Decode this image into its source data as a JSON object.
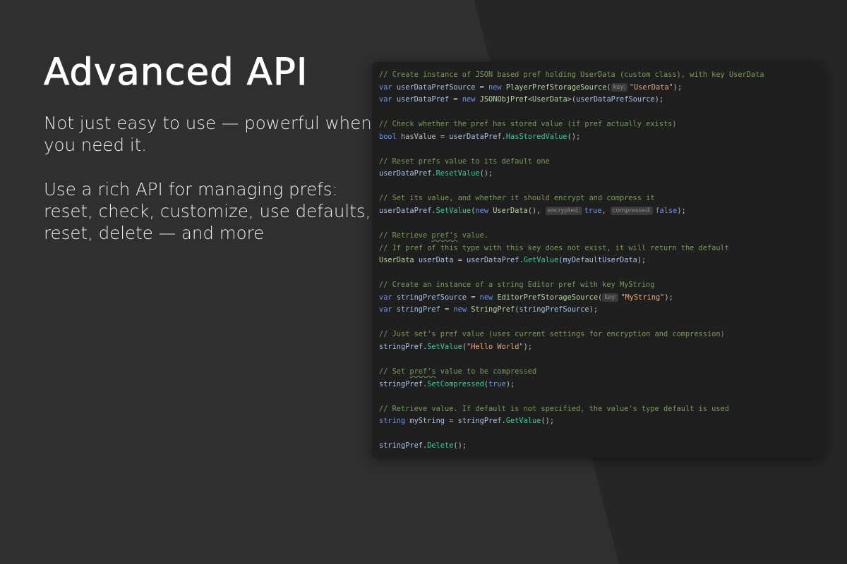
{
  "colors": {
    "background": "#2f2f2f",
    "background_shape": "#262626",
    "code_panel_bg": "#1f1f1f",
    "comment": "#7a9a5a",
    "keyword": "#6c95eb",
    "type": "#b8d7a3",
    "method": "#39cc9b",
    "string": "#e9a87d",
    "text": "#bcbec4"
  },
  "hero": {
    "title": "Advanced API",
    "paragraph_1": "Not just easy to use — powerful when you need it.",
    "paragraph_2": "Use a rich API for managing prefs: reset, check, customize, use defaults, reset, delete — and more"
  },
  "code": {
    "lines": [
      [
        {
          "t": "// Create instance of JSON based pref holding UserData (custom class), with key UserData",
          "k": "comment"
        }
      ],
      [
        {
          "t": "var",
          "k": "kw"
        },
        {
          "t": " ",
          "k": "plain"
        },
        {
          "t": "userDataPrefSource",
          "k": "var"
        },
        {
          "t": " = ",
          "k": "plain"
        },
        {
          "t": "new",
          "k": "kw"
        },
        {
          "t": " ",
          "k": "plain"
        },
        {
          "t": "PlayerPrefStorageSource",
          "k": "type"
        },
        {
          "t": "(",
          "k": "plain"
        },
        {
          "t": "key:",
          "k": "hint"
        },
        {
          "t": "\"UserData\"",
          "k": "str"
        },
        {
          "t": ");",
          "k": "plain"
        }
      ],
      [
        {
          "t": "var",
          "k": "kw"
        },
        {
          "t": " ",
          "k": "plain"
        },
        {
          "t": "userDataPref",
          "k": "var"
        },
        {
          "t": " = ",
          "k": "plain"
        },
        {
          "t": "new",
          "k": "kw"
        },
        {
          "t": " ",
          "k": "plain"
        },
        {
          "t": "JSONObjPref",
          "k": "type"
        },
        {
          "t": "<",
          "k": "plain"
        },
        {
          "t": "UserData",
          "k": "type"
        },
        {
          "t": ">(",
          "k": "plain"
        },
        {
          "t": "userDataPrefSource",
          "k": "var"
        },
        {
          "t": ");",
          "k": "plain"
        }
      ],
      [],
      [
        {
          "t": "// Check whether the pref has stored value (if pref actually exists)",
          "k": "comment"
        }
      ],
      [
        {
          "t": "bool",
          "k": "kw"
        },
        {
          "t": " ",
          "k": "plain"
        },
        {
          "t": "hasValue",
          "k": "local"
        },
        {
          "t": " = ",
          "k": "plain"
        },
        {
          "t": "userDataPref",
          "k": "var"
        },
        {
          "t": ".",
          "k": "plain"
        },
        {
          "t": "HasStoredValue",
          "k": "method"
        },
        {
          "t": "();",
          "k": "plain"
        }
      ],
      [],
      [
        {
          "t": "// Reset prefs value to its default one",
          "k": "comment"
        }
      ],
      [
        {
          "t": "userDataPref",
          "k": "var"
        },
        {
          "t": ".",
          "k": "plain"
        },
        {
          "t": "ResetValue",
          "k": "method"
        },
        {
          "t": "();",
          "k": "plain"
        }
      ],
      [],
      [
        {
          "t": "// Set its value, and whether it should encrypt and compress it",
          "k": "comment"
        }
      ],
      [
        {
          "t": "userDataPref",
          "k": "var"
        },
        {
          "t": ".",
          "k": "plain"
        },
        {
          "t": "SetValue",
          "k": "method"
        },
        {
          "t": "(",
          "k": "plain"
        },
        {
          "t": "new",
          "k": "kw"
        },
        {
          "t": " ",
          "k": "plain"
        },
        {
          "t": "UserData",
          "k": "type"
        },
        {
          "t": "(), ",
          "k": "plain"
        },
        {
          "t": "encrypted:",
          "k": "hint"
        },
        {
          "t": "true",
          "k": "kw"
        },
        {
          "t": ", ",
          "k": "plain"
        },
        {
          "t": "compressed:",
          "k": "hint"
        },
        {
          "t": "false",
          "k": "kw"
        },
        {
          "t": ");",
          "k": "plain"
        }
      ],
      [],
      [
        {
          "t": "// Retrieve ",
          "k": "comment"
        },
        {
          "t": "pref's",
          "k": "comment-squiggle"
        },
        {
          "t": " value.",
          "k": "comment"
        }
      ],
      [
        {
          "t": "// If pref of this type with this key does not exist, it will return the default",
          "k": "comment"
        }
      ],
      [
        {
          "t": "UserData",
          "k": "type"
        },
        {
          "t": " ",
          "k": "plain"
        },
        {
          "t": "userData",
          "k": "var"
        },
        {
          "t": " = ",
          "k": "plain"
        },
        {
          "t": "userDataPref",
          "k": "var"
        },
        {
          "t": ".",
          "k": "plain"
        },
        {
          "t": "GetValue",
          "k": "method"
        },
        {
          "t": "(",
          "k": "plain"
        },
        {
          "t": "myDefaultUserData",
          "k": "var"
        },
        {
          "t": ");",
          "k": "plain"
        }
      ],
      [],
      [
        {
          "t": "// Create an instance of a string Editor pref with key MyString",
          "k": "comment"
        }
      ],
      [
        {
          "t": "var",
          "k": "kw"
        },
        {
          "t": " ",
          "k": "plain"
        },
        {
          "t": "stringPrefSource",
          "k": "var"
        },
        {
          "t": " = ",
          "k": "plain"
        },
        {
          "t": "new",
          "k": "kw"
        },
        {
          "t": " ",
          "k": "plain"
        },
        {
          "t": "EditorPrefStorageSource",
          "k": "type"
        },
        {
          "t": "(",
          "k": "plain"
        },
        {
          "t": "key:",
          "k": "hint"
        },
        {
          "t": "\"MyString\"",
          "k": "str"
        },
        {
          "t": ");",
          "k": "plain"
        }
      ],
      [
        {
          "t": "var",
          "k": "kw"
        },
        {
          "t": " ",
          "k": "plain"
        },
        {
          "t": "stringPref",
          "k": "var"
        },
        {
          "t": " = ",
          "k": "plain"
        },
        {
          "t": "new",
          "k": "kw"
        },
        {
          "t": " ",
          "k": "plain"
        },
        {
          "t": "StringPref",
          "k": "type"
        },
        {
          "t": "(",
          "k": "plain"
        },
        {
          "t": "stringPrefSource",
          "k": "var"
        },
        {
          "t": ");",
          "k": "plain"
        }
      ],
      [],
      [
        {
          "t": "// Just set's pref value (uses current settings for encryption and compression)",
          "k": "comment"
        }
      ],
      [
        {
          "t": "stringPref",
          "k": "var"
        },
        {
          "t": ".",
          "k": "plain"
        },
        {
          "t": "SetValue",
          "k": "method"
        },
        {
          "t": "(",
          "k": "plain"
        },
        {
          "t": "\"Hello World\"",
          "k": "str"
        },
        {
          "t": ");",
          "k": "plain"
        }
      ],
      [],
      [
        {
          "t": "// Set ",
          "k": "comment"
        },
        {
          "t": "pref's",
          "k": "comment-squiggle"
        },
        {
          "t": " value to be compressed",
          "k": "comment"
        }
      ],
      [
        {
          "t": "stringPref",
          "k": "var"
        },
        {
          "t": ".",
          "k": "plain"
        },
        {
          "t": "SetCompressed",
          "k": "method"
        },
        {
          "t": "(",
          "k": "plain"
        },
        {
          "t": "true",
          "k": "kw"
        },
        {
          "t": ");",
          "k": "plain"
        }
      ],
      [],
      [
        {
          "t": "// Retrieve value. If default is not specified, the value's type default is used",
          "k": "comment"
        }
      ],
      [
        {
          "t": "string",
          "k": "kw"
        },
        {
          "t": " ",
          "k": "plain"
        },
        {
          "t": "myString",
          "k": "var"
        },
        {
          "t": " = ",
          "k": "plain"
        },
        {
          "t": "stringPref",
          "k": "var"
        },
        {
          "t": ".",
          "k": "plain"
        },
        {
          "t": "GetValue",
          "k": "method"
        },
        {
          "t": "();",
          "k": "plain"
        }
      ],
      [],
      [
        {
          "t": "stringPref",
          "k": "var"
        },
        {
          "t": ".",
          "k": "plain"
        },
        {
          "t": "Delete",
          "k": "method"
        },
        {
          "t": "();",
          "k": "plain"
        }
      ]
    ]
  }
}
